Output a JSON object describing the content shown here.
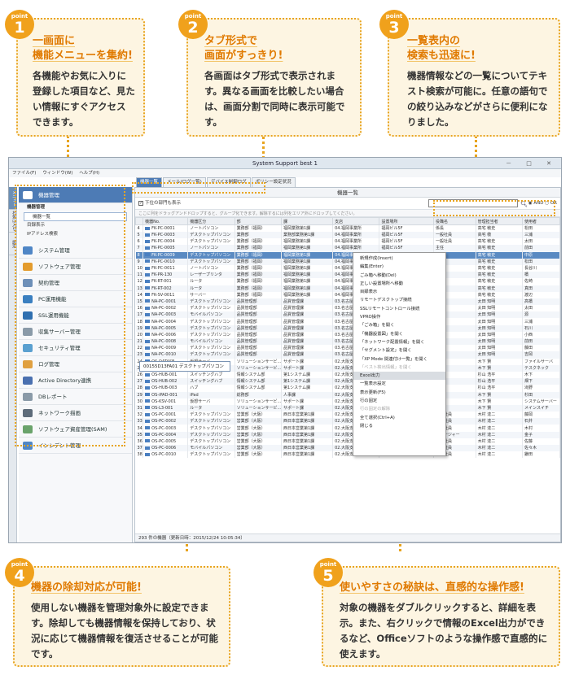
{
  "points": [
    {
      "label": "point",
      "num": "1",
      "title": [
        "一画面に",
        "機能メニューを集約!"
      ],
      "body": "各機能やお気に入りに登録した項目など、見たい情報にすぐアクセスできます。"
    },
    {
      "label": "point",
      "num": "2",
      "title": [
        "タブ形式で",
        "画面がすっきり!"
      ],
      "body": "各画面はタブ形式で表示されます。異なる画面を比較したい場合は、画面分割で同時に表示可能です。"
    },
    {
      "label": "point",
      "num": "3",
      "title": [
        "一覧表内の",
        "検索も迅速に!"
      ],
      "body": "機器情報などの一覧についてテキスト検索が可能に。任意の語句での絞り込みなどがさらに便利になりました。"
    },
    {
      "label": "point",
      "num": "4",
      "title": [
        "機器の除却対応が可能!"
      ],
      "body": "使用しない機器を管理対象外に設定できます。除却しても機器情報を保持しており、状況に応じて機器情報を復活させることが可能です。"
    },
    {
      "label": "point",
      "num": "5",
      "title": [
        "使いやすさの秘訣は、直感的な操作感!"
      ],
      "body": "対象の機器をダブルクリックすると、詳細を表示。また、右クリックで情報のExcel出力ができるなど、Officeソフトのような操作感で直感的に使えます。"
    }
  ],
  "app": {
    "title": "System Support best 1",
    "window_buttons": "－ □ ✕",
    "menu": [
      "ファイル(F)",
      "ウィンドウ(W)",
      "ヘルプ(H)"
    ],
    "side_tabs": [
      "メニュー",
      "お気に入り",
      "設定"
    ],
    "sidebar": {
      "header": "機器管理",
      "group": "機器管理",
      "subs": [
        "機器一覧",
        "目録表示",
        "IPアドレス検索"
      ],
      "items": [
        {
          "label": "システム管理",
          "color": "#4f86c6"
        },
        {
          "label": "ソフトウェア管理",
          "color": "#e39b2d"
        },
        {
          "label": "契約管理",
          "color": "#6d8fb8"
        },
        {
          "label": "PC運用機能",
          "color": "#3a7fc0"
        },
        {
          "label": "SSL運用機能",
          "color": "#2f6fb0"
        },
        {
          "label": "収集サーバー管理",
          "color": "#8a9aa8"
        },
        {
          "label": "セキュリティ管理",
          "color": "#5aa0d0"
        },
        {
          "label": "ログ管理",
          "color": "#e0a040"
        },
        {
          "label": "Active Directory連携",
          "color": "#4a70b0"
        },
        {
          "label": "DBレポート",
          "color": "#8a9aa8"
        },
        {
          "label": "ネットワーク描画",
          "color": "#5d6b7a"
        },
        {
          "label": "ソフトウェア資産管理(SAM)",
          "color": "#6aa36b"
        },
        {
          "label": "インシデント管理",
          "color": "#4f86c6"
        }
      ]
    },
    "tabs": [
      "機器一覧",
      "メール(ログ一覧)",
      "デバイス制御ログ",
      "ポリシー設定状況"
    ],
    "panel_title": "機器一覧",
    "show_sub_label": "下位の部門も表示",
    "search": {
      "placeholder": "",
      "and": "AND",
      "or": "OR"
    },
    "group_hint": "ここに列をドラッグアンドドロップすると、グループ化できます。解除するには列をエリア外にドロップしてください。",
    "columns": [
      "機器No.",
      "機器区分",
      "部",
      "課",
      "支店",
      "設置場所",
      "役職名",
      "管理担当者",
      "使用者"
    ],
    "rows": [
      [
        "4",
        "FK-PC-0001",
        "ノートパソコン",
        "業務部（福岡）",
        "福岡業務第1課",
        "04.福岡事業所",
        "福岡ビル5F",
        "係長",
        "高宅 敏史",
        "松田"
      ],
      [
        "5",
        "FK-PC-0003",
        "デスクトップパソコン",
        "業務部",
        "業務部業務第1課",
        "04.福岡事業所",
        "福岡ビル5F",
        "一般社員",
        "高宅 敬",
        "三浦"
      ],
      [
        "6",
        "FK-PC-0004",
        "デスクトップパソコン",
        "業務部（福岡）",
        "福岡業務第1課",
        "04.福岡事業所",
        "福岡ビル5F",
        "一般社員",
        "高宅 敏史",
        "太田"
      ],
      [
        "7",
        "FK-PC-0005",
        "ノートパソコン",
        "業務部（福岡）",
        "福岡業務第1課",
        "04.福岡事業所",
        "福岡ビル5F",
        "主任",
        "高宅 敏史",
        "前田"
      ],
      [
        "8",
        "FK-PC-0009",
        "デスクトップパソコン",
        "業務部（福岡）",
        "福岡業務第1課",
        "04.福岡事業所",
        "",
        "",
        "高宅 敏史",
        "中原"
      ],
      [
        "9",
        "FK-PC-0010",
        "デスクトップパソコン",
        "業務部（福岡）",
        "福岡業務第1課",
        "04.福岡事業所",
        "",
        "",
        "高宅 敏史",
        "松田"
      ],
      [
        "10",
        "FK-PC-0011",
        "ノートパソコン",
        "業務部（福岡）",
        "福岡業務第1課",
        "04.福岡事業所",
        "",
        "",
        "高宅 敏史",
        "長谷川"
      ],
      [
        "11",
        "FK-PR-130",
        "レーザープリンタ",
        "業務部（福岡）",
        "福岡業務第1課",
        "04.福岡事業所",
        "",
        "",
        "高宅 敏史",
        "橋"
      ],
      [
        "12",
        "FK-RT-001",
        "ルータ",
        "業務部（福岡）",
        "福岡業務第1課",
        "04.福岡事業所",
        "",
        "",
        "高宅 敏史",
        "佐崎"
      ],
      [
        "13",
        "FK-RT-002",
        "ルータ",
        "業務部（福岡）",
        "福岡業務第1課",
        "04.福岡事業所",
        "",
        "",
        "高宅 敏史",
        "真田"
      ],
      [
        "14",
        "FK-SV-0011",
        "サーバー",
        "業務部（福岡）",
        "福岡業務第1課",
        "04.福岡事業所",
        "",
        "",
        "高宅 敏史",
        "渡辺"
      ],
      [
        "15",
        "NA-PC-0001",
        "デスクトップパソコン",
        "品質管理部",
        "品質管理課",
        "03.名古屋事業所",
        "",
        "",
        "太田 知明",
        "高橋"
      ],
      [
        "16",
        "NA-PC-0002",
        "デスクトップパソコン",
        "品質管理部",
        "品質管理課",
        "03.名古屋事業所",
        "",
        "",
        "太田 知明",
        "太田"
      ],
      [
        "17",
        "NA-PC-0003",
        "モバイルパソコン",
        "品質管理部",
        "品質管理課",
        "03.名古屋事業所",
        "",
        "",
        "太田 知明",
        "源"
      ],
      [
        "18",
        "NA-PC-0004",
        "デスクトップパソコン",
        "品質管理部",
        "品質管理課",
        "03.名古屋事業所",
        "",
        "",
        "太田 知明",
        "三浦"
      ],
      [
        "19",
        "NA-PC-0005",
        "デスクトップパソコン",
        "品質管理部",
        "品質管理課",
        "03.名古屋事業所",
        "",
        "",
        "太田 知明",
        "石川"
      ],
      [
        "20",
        "NA-PC-0006",
        "デスクトップパソコン",
        "品質管理部",
        "品質管理課",
        "03.名古屋事業所",
        "",
        "",
        "太田 知明",
        "小西"
      ],
      [
        "21",
        "NA-PC-0008",
        "モバイルパソコン",
        "品質管理部",
        "品質管理課",
        "03.名古屋事業所",
        "",
        "",
        "太田 知明",
        "前田"
      ],
      [
        "22",
        "NA-PC-0009",
        "デスクトップパソコン",
        "品質管理部",
        "品質管理課",
        "03.名古屋事業所",
        "",
        "",
        "太田 知明",
        "藤田"
      ],
      [
        "23",
        "NA-PC-0010",
        "デスクトップパソコン",
        "品質管理部",
        "品質管理課",
        "03.名古屋事業所",
        "",
        "",
        "太田 知明",
        "吉岡"
      ],
      [
        "24",
        "OS-DATASE...",
        "仮想サーバ",
        "ソリューションサービ...",
        "サポート課",
        "02.大阪支店",
        "",
        "",
        "木下 賢",
        "ファイルサーバ"
      ],
      [
        "25",
        "OS-DEBKNE...",
        "仮想サーバ",
        "ソリューションサービ...",
        "サポート課",
        "02.大阪支店",
        "",
        "",
        "木下 賢",
        "テスクネック"
      ],
      [
        "26",
        "OS-HUB-001",
        "スイッチングハブ",
        "情報システム部",
        "第1システム課",
        "02.大阪支店",
        "",
        "",
        "杉山 浩平",
        "木下"
      ],
      [
        "27",
        "OS-HUB-002",
        "スイッチングハブ",
        "情報システム部",
        "第1システム課",
        "02.大阪支店",
        "",
        "",
        "杉山 浩平",
        "畑下"
      ],
      [
        "28",
        "OS-HUB-003",
        "ハブ",
        "情報システム部",
        "第1システム課",
        "02.大阪支店",
        "",
        "",
        "杉山 浩平",
        "滝野"
      ],
      [
        "29",
        "OS-iPAD-001",
        "iPad",
        "総務部",
        "人事課",
        "02.大阪支店",
        "",
        "",
        "木下 賢",
        "杉田"
      ],
      [
        "30",
        "OS-KSV-001",
        "仮想サーバ",
        "ソリューションサービ...",
        "サポート課",
        "02.大阪支店",
        "",
        "",
        "木下 賢",
        "システムサーバー"
      ],
      [
        "31",
        "OS-L3-001",
        "ルータ",
        "ソリューションサービ...",
        "サポート課",
        "02.大阪支店",
        "4F：サーバー室(無線...",
        "",
        "木下 賢",
        "メインスイチ"
      ],
      [
        "32",
        "OS-PC-0001",
        "デスクトップパソコン",
        "営業部（大阪）",
        "西日本営業第1課",
        "02.大阪支店",
        "3F：大阪営業部",
        "一般社員",
        "木村 達二",
        "藤岡"
      ],
      [
        "33",
        "OS-PC-0002",
        "デスクトップパソコン",
        "営業部（大阪）",
        "西日本営業第1課",
        "02.大阪支店",
        "3F：大阪営業部",
        "一般社員",
        "木村 達二",
        "石井"
      ],
      [
        "34",
        "OS-PC-0003",
        "デスクトップパソコン",
        "営業部（大阪）",
        "西日本営業第1課",
        "02.大阪支店",
        "3F：大阪営業部",
        "一般社員",
        "木村 達二",
        "木村"
      ],
      [
        "35",
        "OS-PC-0004",
        "デスクトップパソコン",
        "営業部（大阪）",
        "西日本営業第1課",
        "02.大阪支店",
        "3F：大阪営業部",
        "マネージャー",
        "木村 達二",
        "金子"
      ],
      [
        "36",
        "OS-PC-0005",
        "デスクトップパソコン",
        "営業部（大阪）",
        "西日本営業第1課",
        "02.大阪支店",
        "3F：大阪営業部",
        "一般社員",
        "木村 達二",
        "佐藤"
      ],
      [
        "37",
        "OS-PC-0006",
        "モバイルパソコン",
        "営業部（大阪）",
        "西日本営業第1課",
        "02.大阪支店",
        "3F：大阪営業部",
        "一般社員",
        "木村 達二",
        "佐々木"
      ],
      [
        "38",
        "OS-PC-0010",
        "デスクトップパソコン",
        "営業部（大阪）",
        "西日本営業第1課",
        "02.大阪支店",
        "3F：大阪営業部",
        "一般社員",
        "木村 達二",
        "鎌田"
      ]
    ],
    "selected_row": 4,
    "drag_tooltip": "00155D13FA01  デスクトップパソコン",
    "status": "293 件の機器（更新日時：2015/12/24 10:05:34）",
    "context_menu": [
      {
        "label": "新規作成(Insert)",
        "state": ""
      },
      {
        "label": "編集(Enter)",
        "state": ""
      },
      {
        "label": "ごみ箱へ移動(Del)",
        "state": ""
      },
      {
        "label": "正しい設置場所へ移動",
        "state": ""
      },
      {
        "label": "目録表示",
        "state": ""
      },
      {
        "label": "リモートデスクトップ接続",
        "state": ""
      },
      {
        "label": "SSLリモートコントロール接続",
        "state": ""
      },
      {
        "label": "VPRO操作",
        "state": ""
      },
      {
        "label": "「ごみ箱」を開く",
        "state": ""
      },
      {
        "label": "「機器設置図」を開く",
        "state": ""
      },
      {
        "label": "「ネットワーク配置情報」を開く",
        "state": ""
      },
      {
        "label": "「セグメント設定」を開く",
        "state": ""
      },
      {
        "label": "「XP Mode 関連付け一覧」を開く",
        "state": ""
      },
      {
        "label": "「ベスト検出情報」を開く",
        "state": "dis"
      },
      {
        "label": "Excel出力",
        "state": "sep"
      },
      {
        "label": "一覧表示設定",
        "state": ""
      },
      {
        "label": "表示更新(F5)",
        "state": ""
      },
      {
        "label": "行の固定",
        "state": ""
      },
      {
        "label": "行の固定の解除",
        "state": "dis"
      },
      {
        "label": "全て選択(Ctrl+A)",
        "state": ""
      },
      {
        "label": "閉じる",
        "state": ""
      }
    ]
  }
}
